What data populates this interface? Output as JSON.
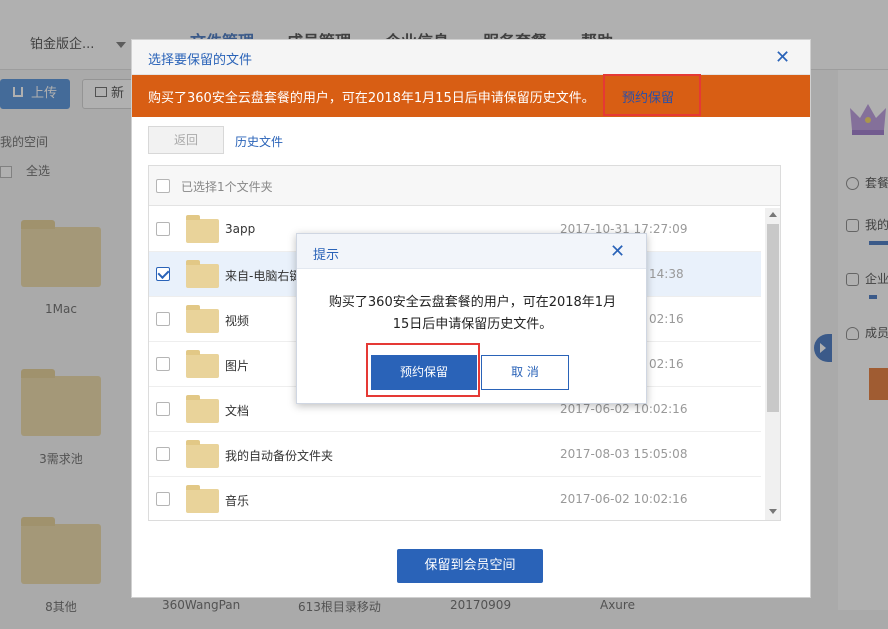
{
  "header": {
    "plan": "铂金版企...",
    "nav": [
      "文件管理",
      "成员管理",
      "企业信息",
      "服务套餐",
      "帮助"
    ]
  },
  "toolbar": {
    "upload": "上传",
    "new": "新"
  },
  "sidebar": {
    "my_space": "我的空间",
    "select_all": "全选"
  },
  "background_folders": [
    "1Mac",
    "3需求池",
    "8其他"
  ],
  "bottom_labels": [
    "360WangPan",
    "613根目录移动",
    "20170909",
    "Axure"
  ],
  "right_panel": {
    "items": [
      "套餐",
      "我的",
      "企业",
      "成员"
    ]
  },
  "dialog": {
    "title": "选择要保留的文件",
    "notice": "购买了360安全云盘套餐的用户，可在2018年1月15日后申请保留历史文件。",
    "notice_link": "预约保留",
    "back": "返回",
    "history": "历史文件",
    "selected_count": "已选择1个文件夹",
    "files": [
      {
        "name": "3app",
        "date": "2017-10-31 17:27:09",
        "checked": false
      },
      {
        "name": "来自-电脑右键",
        "date": "14:38",
        "checked": true
      },
      {
        "name": "视频",
        "date": "02:16",
        "checked": false
      },
      {
        "name": "图片",
        "date": "02:16",
        "checked": false
      },
      {
        "name": "文档",
        "date": "2017-06-02 10:02:16",
        "checked": false
      },
      {
        "name": "我的自动备份文件夹",
        "date": "2017-08-03 15:05:08",
        "checked": false
      },
      {
        "name": "音乐",
        "date": "2017-06-02 10:02:16",
        "checked": false
      }
    ],
    "save_button": "保留到会员空间"
  },
  "prompt": {
    "title": "提示",
    "message_line1": "购买了360安全云盘套餐的用户，可在2018年1月",
    "message_line2": "15日后申请保留历史文件。",
    "confirm": "预约保留",
    "cancel": "取 消"
  },
  "colors": {
    "accent": "#2a63b8",
    "notice_bg": "#d85e14",
    "highlight": "#e53935",
    "folder": "#e9d39a"
  }
}
